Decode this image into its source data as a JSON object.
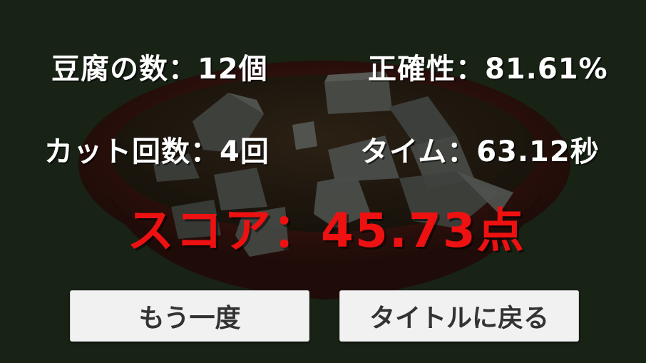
{
  "results": {
    "tofu_count": "豆腐の数：12個",
    "accuracy": "正確性：81.61%",
    "cut_count": "カット回数：4回",
    "time": "タイム：63.12秒"
  },
  "score": "スコア：45.73点",
  "buttons": {
    "retry": "もう一度",
    "back_to_title": "タイトルに戻る"
  },
  "colors": {
    "background": "#1f2a1d",
    "bowl": "#3a0e0e",
    "score_text": "#ee1111",
    "stat_text": "#ffffff",
    "button_bg": "#f1f1f1"
  }
}
